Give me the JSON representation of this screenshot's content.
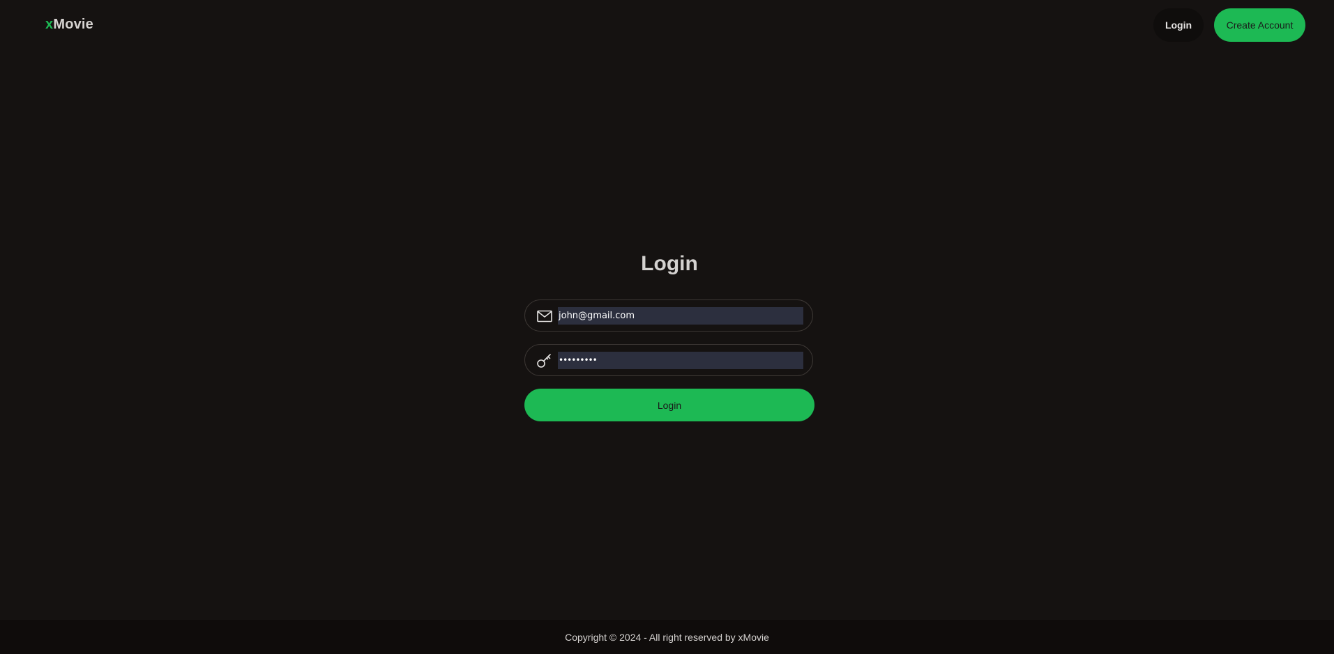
{
  "header": {
    "logo_accent": "x",
    "logo_rest": "Movie",
    "login_label": "Login",
    "create_account_label": "Create Account"
  },
  "login": {
    "title": "Login",
    "email_value": "john@gmail.com",
    "password_value": "•••••••••",
    "submit_label": "Login"
  },
  "footer": {
    "copyright": "Copyright © 2024 - All right reserved by xMovie"
  },
  "icons": {
    "email": "envelope-icon",
    "password": "key-icon"
  },
  "colors": {
    "accent": "#1db954",
    "background": "#151211",
    "footer_bg": "#0f0c0b",
    "input_bg": "#2c2f3e"
  }
}
